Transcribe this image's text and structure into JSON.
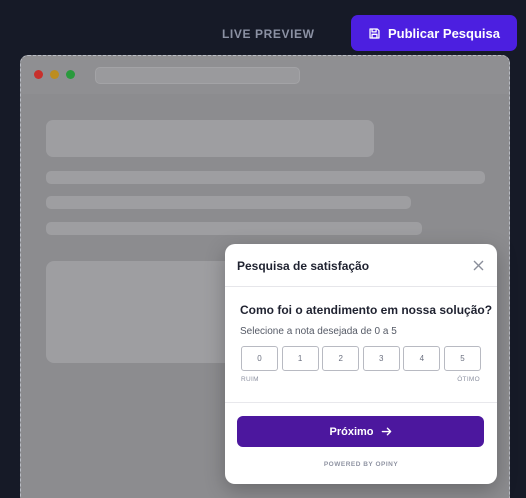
{
  "header": {
    "live_preview_label": "LIVE PREVIEW",
    "publish_button_label": "Publicar Pesquisa",
    "publish_icon": "save-icon"
  },
  "colors": {
    "background": "#161a27",
    "accent": "#4c1fe0",
    "next_button": "#4c179e"
  },
  "survey": {
    "title": "Pesquisa de satisfação",
    "close_icon": "close-icon",
    "question": "Como foi o atendimento em nossa solução?",
    "hint": "Selecione a nota desejada de 0 a 5",
    "scale": [
      "0",
      "1",
      "2",
      "3",
      "4",
      "5"
    ],
    "scale_min_label": "RUIM",
    "scale_max_label": "ÓTIMO",
    "next_button_label": "Próximo",
    "next_icon": "arrow-right-icon",
    "powered_by": "POWERED BY OPINY"
  }
}
